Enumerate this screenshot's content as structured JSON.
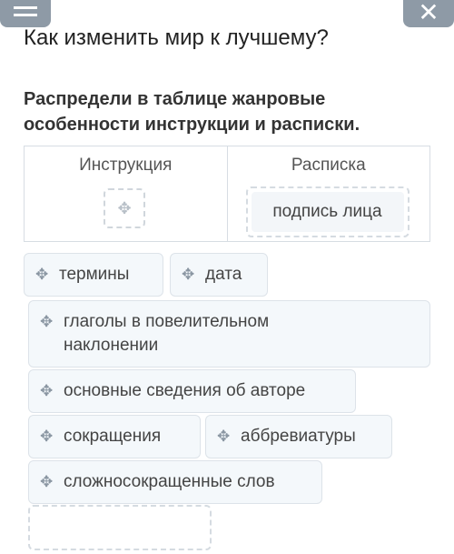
{
  "header": {
    "menu_icon": "menu-icon",
    "close_icon": "close-icon"
  },
  "title": "Как изменить мир к лучшему?",
  "instruction": "Распредели в таблице жанровые особенности инструкции и расписки.",
  "table": {
    "columns": [
      {
        "label": "Инструкция",
        "items": []
      },
      {
        "label": "Расписка",
        "items": [
          "подпись лица"
        ]
      }
    ]
  },
  "chips": [
    "термины",
    "дата",
    "глаголы в повелительном наклонении",
    "основные сведения об авторе",
    "сокращения",
    "аббревиатуры",
    "сложносокращенные слов"
  ],
  "move_icon_glyph": "✥"
}
